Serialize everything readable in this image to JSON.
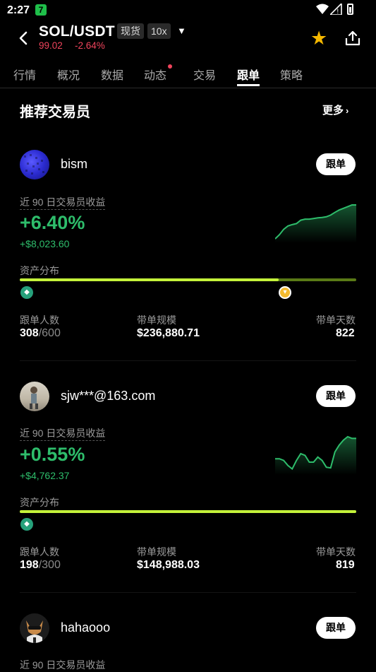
{
  "status_bar": {
    "time": "2:27",
    "app_icon_letter": "7"
  },
  "header": {
    "pair": "SOL/USDT",
    "market_tag": "现货",
    "leverage_tag": "10x",
    "price": "99.02",
    "change": "-2.64%"
  },
  "tabs": [
    {
      "label": "行情"
    },
    {
      "label": "概况"
    },
    {
      "label": "数据"
    },
    {
      "label": "动态"
    },
    {
      "label": "交易"
    },
    {
      "label": "跟单"
    },
    {
      "label": "策略"
    }
  ],
  "active_tab": "跟单",
  "section": {
    "title": "推荐交易员",
    "more": "更多"
  },
  "follow_label": "跟单",
  "labels": {
    "pnl": "近 90 日交易员收益",
    "assets": "资产分布",
    "followers": "跟单人数",
    "aum": "带单规模",
    "days": "带单天数"
  },
  "traders": [
    {
      "name": "bism",
      "pnl_pct": "+6.40%",
      "pnl_amt": "+$8,023.60",
      "followers": "308",
      "followers_max": "/600",
      "aum": "$236,880.71",
      "days": "822",
      "asset_split": 0.77,
      "coins": [
        "usdt-icon",
        "bnb-icon"
      ],
      "sparkline": [
        0.0,
        0.12,
        0.28,
        0.38,
        0.42,
        0.45,
        0.55,
        0.58,
        0.58,
        0.6,
        0.62,
        0.63,
        0.65,
        0.7,
        0.78,
        0.85,
        0.9,
        0.95,
        1.0,
        1.0
      ]
    },
    {
      "name": "sjw***@163.com",
      "pnl_pct": "+0.55%",
      "pnl_amt": "+$4,762.37",
      "followers": "198",
      "followers_max": "/300",
      "aum": "$148,988.03",
      "days": "819",
      "asset_split": 1.0,
      "coins": [
        "usdt-icon"
      ],
      "sparkline": [
        0.35,
        0.35,
        0.3,
        0.15,
        0.05,
        0.3,
        0.5,
        0.45,
        0.25,
        0.25,
        0.4,
        0.3,
        0.1,
        0.08,
        0.55,
        0.75,
        0.9,
        1.0,
        0.95,
        0.95
      ]
    },
    {
      "name": "hahaooo",
      "pnl_label": "近 90 日交易员收益"
    }
  ],
  "colors": {
    "accent_green": "#2ebd6b",
    "accent_red": "#f0445c",
    "bar_lime": "#c4f23a",
    "bar_olive": "#5a7a16",
    "star": "#f5b800"
  }
}
